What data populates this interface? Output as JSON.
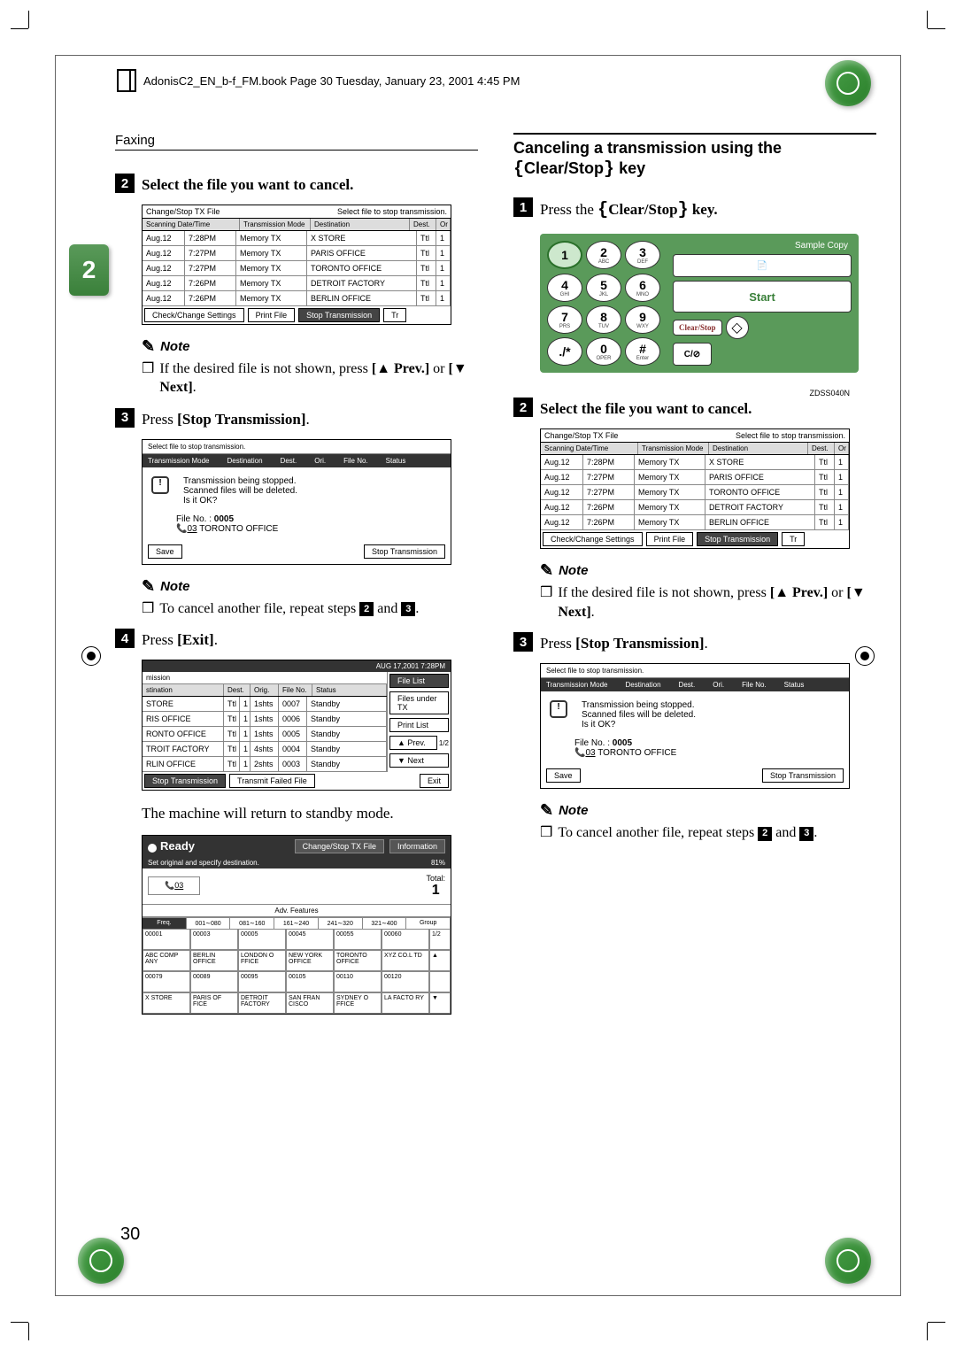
{
  "book_header": "AdonisC2_EN_b-f_FM.book  Page 30  Tuesday, January 23, 2001  4:45 PM",
  "section": "Faxing",
  "side_tab": "2",
  "page_number": "30",
  "left": {
    "step2": {
      "num": "2",
      "text_a": "Select the file you want to cancel."
    },
    "step3": {
      "num": "3",
      "text": "Press ",
      "bold": "[Stop Transmission]",
      "suffix": "."
    },
    "step4": {
      "num": "4",
      "text": "Press ",
      "bold": "[Exit]",
      "suffix": "."
    },
    "note1": {
      "title": "Note",
      "body": "If the desired file is not shown, press ",
      "b1": "[▲ Prev.]",
      "mid": " or ",
      "b2": "[▼ Next]",
      "end": "."
    },
    "note2": {
      "title": "Note",
      "body_a": "To cancel another file, repeat steps ",
      "n1": "2",
      "mid": " and ",
      "n2": "3",
      "end": "."
    },
    "standby_text": "The machine will return to standby mode."
  },
  "right": {
    "title_a": "Canceling a transmission using the",
    "title_b_l": "{",
    "title_b": "Clear/Stop",
    "title_b_r": "}",
    "title_c": " key",
    "step1": {
      "num": "1",
      "text": "Press the ",
      "bl": "{",
      "bold": "Clear/Stop",
      "br": "}",
      "suffix": " key."
    },
    "step2": {
      "num": "2",
      "text": "Select the file you want to cancel."
    },
    "step3": {
      "num": "3",
      "text": "Press ",
      "bold": "[Stop Transmission]",
      "suffix": "."
    },
    "note1": {
      "title": "Note",
      "body": "If the desired file is not shown, press ",
      "b1": "[▲ Prev.]",
      "mid": " or ",
      "b2": "[▼ Next]",
      "end": "."
    },
    "note2": {
      "title": "Note",
      "body_a": "To cancel another file, repeat steps ",
      "n1": "2",
      "mid": " and ",
      "n2": "3",
      "end": "."
    },
    "keypad_caption": "ZDSS040N"
  },
  "filelist": {
    "caption_l": "Change/Stop TX File",
    "caption_r": "Select file to stop transmission.",
    "h_date": "Scanning Date/Time",
    "h_mode": "Transmission Mode",
    "h_dest": "Destination",
    "h_destn": "Dest.",
    "h_or": "Or",
    "rows": [
      {
        "d": "Aug.12",
        "t": "7:28PM",
        "m": "Memory TX",
        "dest": "X STORE",
        "dn": "Ttl",
        "dv": "1"
      },
      {
        "d": "Aug.12",
        "t": "7:27PM",
        "m": "Memory TX",
        "dest": "PARIS OFFICE",
        "dn": "Ttl",
        "dv": "1"
      },
      {
        "d": "Aug.12",
        "t": "7:27PM",
        "m": "Memory TX",
        "dest": "TORONTO OFFICE",
        "dn": "Ttl",
        "dv": "1"
      },
      {
        "d": "Aug.12",
        "t": "7:26PM",
        "m": "Memory TX",
        "dest": "DETROIT FACTORY",
        "dn": "Ttl",
        "dv": "1"
      },
      {
        "d": "Aug.12",
        "t": "7:26PM",
        "m": "Memory TX",
        "dest": "BERLIN OFFICE",
        "dn": "Ttl",
        "dv": "1"
      }
    ],
    "footer": {
      "check": "Check/Change Settings",
      "print": "Print File",
      "stop": "Stop Transmission",
      "tr": "Tr"
    }
  },
  "confirm": {
    "top": "Select file to stop transmission.",
    "hdr": [
      "Transmission Mode",
      "Destination",
      "Dest.",
      "Ori.",
      "File No.",
      "Status"
    ],
    "l1": "Transmission being stopped.",
    "l2": "Scanned files will be deleted.",
    "l3": "Is it OK?",
    "fno_label": "File No. : ",
    "fno": "0005",
    "dest_icon": "03",
    "dest": "TORONTO OFFICE",
    "save": "Save",
    "stop": "Stop Transmission"
  },
  "txlist": {
    "topbar": "AUG  17,2001  7:28PM",
    "title": "mission",
    "h": [
      "stination",
      "Dest.",
      "Orig.",
      "File No.",
      "Status"
    ],
    "rows": [
      {
        "dest": "STORE",
        "d": "Ttl",
        "dv": "1",
        "o": "1shts",
        "f": "0007",
        "s": "Standby"
      },
      {
        "dest": "RIS OFFICE",
        "d": "Ttl",
        "dv": "1",
        "o": "1shts",
        "f": "0006",
        "s": "Standby"
      },
      {
        "dest": "RONTO OFFICE",
        "d": "Ttl",
        "dv": "1",
        "o": "1shts",
        "f": "0005",
        "s": "Standby"
      },
      {
        "dest": "TROIT FACTORY",
        "d": "Ttl",
        "dv": "1",
        "o": "4shts",
        "f": "0004",
        "s": "Standby"
      },
      {
        "dest": "RLIN OFFICE",
        "d": "Ttl",
        "dv": "1",
        "o": "2shts",
        "f": "0003",
        "s": "Standby"
      }
    ],
    "side": [
      "File List",
      "Files under TX",
      "Print List",
      "▲ Prev.",
      "1/2",
      "▼ Next"
    ],
    "footer": {
      "stop": "Stop Transmission",
      "fail": "Transmit Failed File",
      "exit": "Exit"
    }
  },
  "ready": {
    "title": "Ready",
    "btn1": "Change/Stop TX File",
    "btn2": "Information",
    "pct": "81%",
    "sub": "Set original and specify destination.",
    "dest": "03",
    "total_l": "Total:",
    "total_v": "1",
    "adv": "Adv. Features",
    "tabs": [
      "Freq.",
      "001∼080",
      "081∼160",
      "161∼240",
      "241∼320",
      "321∼400",
      "Group"
    ],
    "cells": [
      [
        "00001",
        "00003",
        "00005",
        "00045",
        "00055",
        "00060",
        "1/2"
      ],
      [
        "ABC COMP ANY",
        "BERLIN OFFICE",
        "LONDON O FFICE",
        "NEW YORK OFFICE",
        "TORONTO OFFICE",
        "XYZ CO.L TD",
        "▲"
      ],
      [
        "00079",
        "00089",
        "00095",
        "00105",
        "00110",
        "00120",
        ""
      ],
      [
        "X STORE",
        "PARIS OF FICE",
        "DETROIT FACTORY",
        "SAN FRAN CISCO",
        "SYDNEY O FFICE",
        "LA FACTO RY",
        "▼"
      ]
    ]
  },
  "keypad": {
    "sample_copy": "Sample  Copy",
    "start": "Start",
    "clear_stop": "Clear/Stop",
    "keys": [
      {
        "d": "1",
        "l": ""
      },
      {
        "d": "2",
        "l": "ABC"
      },
      {
        "d": "3",
        "l": "DEF"
      },
      {
        "d": "4",
        "l": "GHI"
      },
      {
        "d": "5",
        "l": "JKL"
      },
      {
        "d": "6",
        "l": "MNO"
      },
      {
        "d": "7",
        "l": "PRS"
      },
      {
        "d": "8",
        "l": "TUV"
      },
      {
        "d": "9",
        "l": "WXY"
      },
      {
        "d": "./*",
        "l": ""
      },
      {
        "d": "0",
        "l": "OPER"
      },
      {
        "d": "#",
        "l": "Enter"
      }
    ],
    "co": "C/⊘"
  }
}
